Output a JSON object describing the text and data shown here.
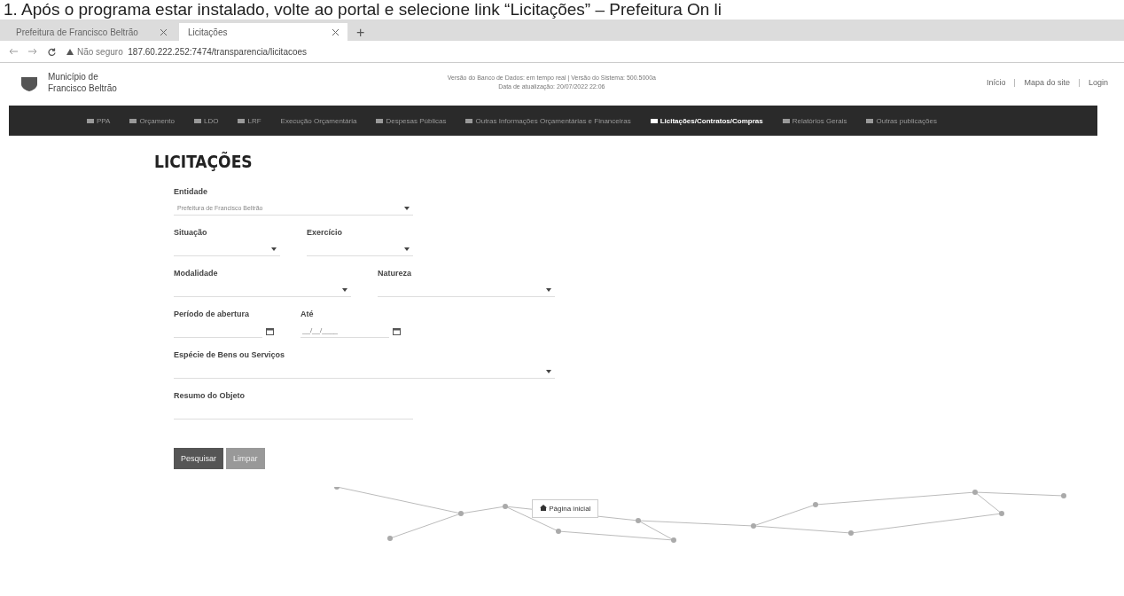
{
  "caption": "1. Após o programa estar instalado, volte ao portal e selecione link “Licitações” – Prefeitura On li",
  "browser": {
    "tabs": [
      {
        "label": "Prefeitura de Francisco Beltrão",
        "selected": false
      },
      {
        "label": "Licitações",
        "selected": true
      }
    ],
    "new_tab": "+",
    "security": "Não seguro",
    "url": "187.60.222.252:7474/transparencia/licitacoes"
  },
  "header": {
    "logo_line1": "Município de",
    "logo_line2": "Francisco Beltrão",
    "info_line1": "Versão do Banco de Dados: em tempo real  |  Versão do Sistema: 500.5000a",
    "info_line2": "Data de atualização: 20/07/2022 22:06",
    "links": [
      "Início",
      "Mapa do site",
      "Login"
    ]
  },
  "nav": [
    {
      "label": "PPA",
      "selected": false
    },
    {
      "label": "Orçamento",
      "selected": false
    },
    {
      "label": "LDO",
      "selected": false
    },
    {
      "label": "LRF",
      "selected": false
    },
    {
      "label": "Execução Orçamentária",
      "selected": false
    },
    {
      "label": "Despesas Públicas",
      "selected": false
    },
    {
      "label": "Outras Informações Orçamentárias e Financeiras",
      "selected": false
    },
    {
      "label": "Licitações/Contratos/Compras",
      "selected": true
    },
    {
      "label": "Relatórios Gerais",
      "selected": false
    },
    {
      "label": "Outras publicações",
      "selected": false
    }
  ],
  "page_title": "LICITAÇÕES",
  "form": {
    "entidade": {
      "label": "Entidade",
      "value": "Prefeitura de Francisco Beltrão"
    },
    "situacao": {
      "label": "Situação"
    },
    "exercicio": {
      "label": "Exercício"
    },
    "modalidade": {
      "label": "Modalidade"
    },
    "natureza": {
      "label": "Natureza"
    },
    "periodo": {
      "label": "Período de abertura"
    },
    "ate": {
      "label": "Até",
      "placeholder": "__/__/____"
    },
    "especie": {
      "label": "Espécie de Bens ou Serviços"
    },
    "resumo": {
      "label": "Resumo do Objeto"
    },
    "buttons": [
      "Pesquisar",
      "Limpar"
    ]
  },
  "home_button": "Página inicial"
}
